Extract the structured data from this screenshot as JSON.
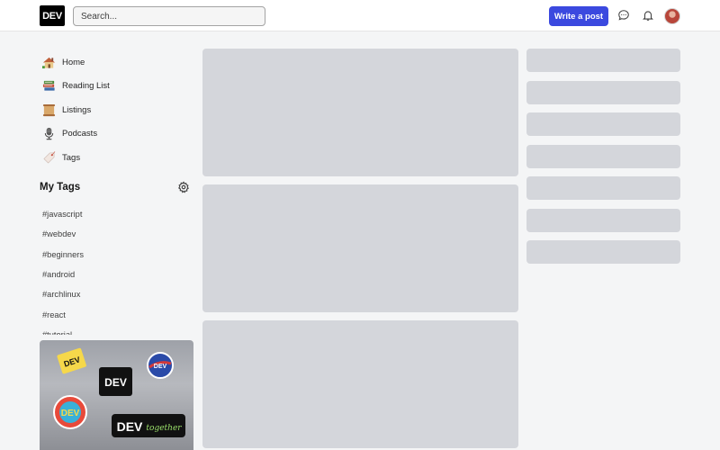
{
  "header": {
    "logo_text": "DEV",
    "search_placeholder": "Search...",
    "write_post_label": "Write a post",
    "chat_icon": "chat-bubble-icon",
    "bell_icon": "bell-icon",
    "avatar_icon": "avatar"
  },
  "sidebar": {
    "items": [
      {
        "label": "Home",
        "icon": "house-icon"
      },
      {
        "label": "Reading List",
        "icon": "books-icon"
      },
      {
        "label": "Listings",
        "icon": "scroll-icon"
      },
      {
        "label": "Podcasts",
        "icon": "microphone-icon"
      },
      {
        "label": "Tags",
        "icon": "tag-icon"
      }
    ],
    "my_tags_title": "My Tags",
    "tags": [
      "#javascript",
      "#webdev",
      "#beginners",
      "#android",
      "#archlinux",
      "#react",
      "#tutorial"
    ]
  },
  "banner": {
    "stickers": [
      "DEV",
      "DEV",
      "DEV",
      "DEV",
      "DEV"
    ],
    "sticker_script": "together"
  },
  "colors": {
    "accent": "#3b49df",
    "background": "#f4f5f6",
    "skeleton": "#d4d6db"
  }
}
